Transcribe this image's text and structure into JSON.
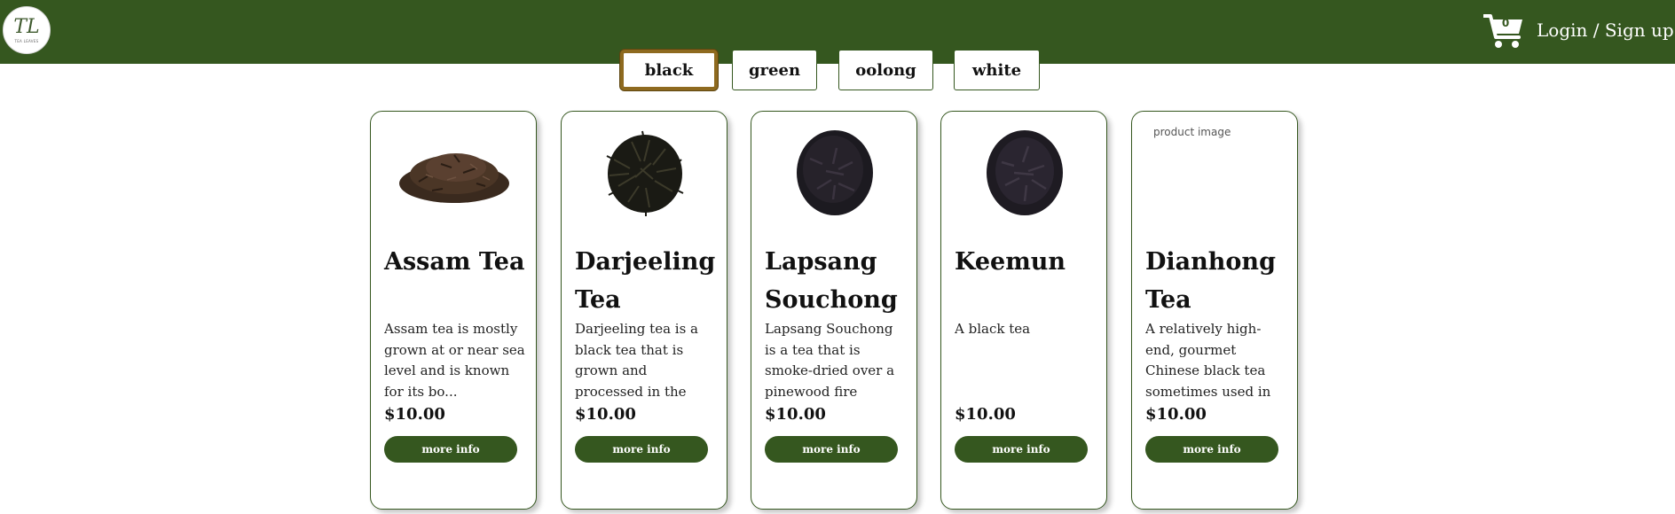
{
  "header": {
    "logo": {
      "mark": "TL",
      "subtitle": "TEA LEAVES"
    },
    "cart": {
      "count": "0"
    },
    "login_label": "Login / Sign up"
  },
  "colors": {
    "brand": "#35571f",
    "active_tab_border": "#8e6a1f"
  },
  "tabs": [
    {
      "label": "black",
      "active": true
    },
    {
      "label": "green",
      "active": false
    },
    {
      "label": "oolong",
      "active": false
    },
    {
      "label": "white",
      "active": false
    }
  ],
  "products": [
    {
      "name": "Assam Tea",
      "description": "Assam tea is mostly grown at or near sea level and is known for its bo...",
      "price": "$10.00",
      "button": "more info",
      "image": "loose-leaf-pile"
    },
    {
      "name": "Darjeeling Tea",
      "description": "Darjeeling tea is a black tea that is grown and processed in the Darje...",
      "price": "$10.00",
      "button": "more info",
      "image": "wiry-leaf-pile"
    },
    {
      "name": "Lapsang Souchong",
      "description": "Lapsang Souchong is a tea that is smoke-dried over a pinewood fire",
      "price": "$10.00",
      "button": "more info",
      "image": "dark-round-pile"
    },
    {
      "name": "Keemun",
      "description": "A black tea",
      "price": "$10.00",
      "button": "more info",
      "image": "dark-round-pile"
    },
    {
      "name": "Dianhong Tea",
      "description": "A relatively high-end, gourmet Chinese black tea sometimes used in var...",
      "price": "$10.00",
      "button": "more info",
      "image_alt": "product image"
    }
  ]
}
